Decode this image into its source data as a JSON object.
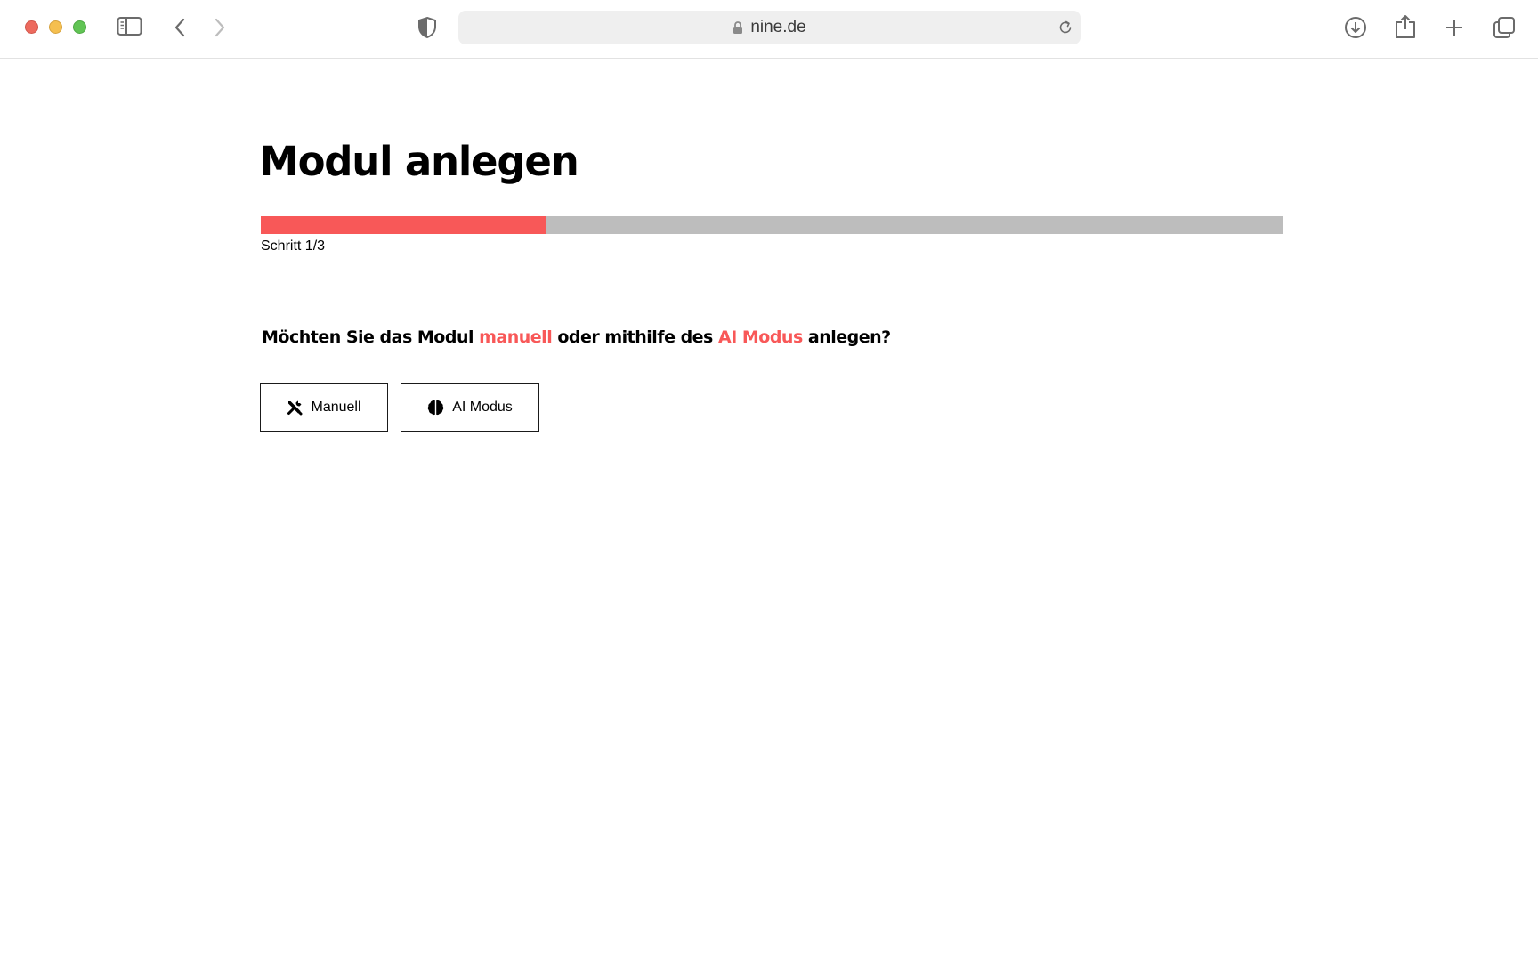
{
  "browser": {
    "url": "nine.de",
    "icons": {
      "sidebar": "sidebar-icon",
      "back": "chevron-left-icon",
      "forward": "chevron-right-icon",
      "shield": "shield-icon",
      "lock": "lock-icon",
      "reload": "reload-icon",
      "download": "download-icon",
      "share": "share-icon",
      "new_tab": "plus-icon",
      "tabs": "tabs-overview-icon"
    }
  },
  "main": {
    "title": "Modul anlegen",
    "progress": {
      "step_label": "Schritt 1/3",
      "fraction": 0.2787,
      "fill_color": "#f85858",
      "track_color": "#bdbdbd"
    },
    "question": {
      "part1": "Möchten Sie das Modul ",
      "highlight1": "manuell",
      "part2": " oder mithilfe des ",
      "highlight2": "AI Modus",
      "part3": " anlegen?",
      "highlight_color": "#f85858"
    },
    "buttons": {
      "manual_label": "Manuell",
      "manual_icon": "tools-icon",
      "ai_label": "AI Modus",
      "ai_icon": "brain-icon"
    }
  }
}
